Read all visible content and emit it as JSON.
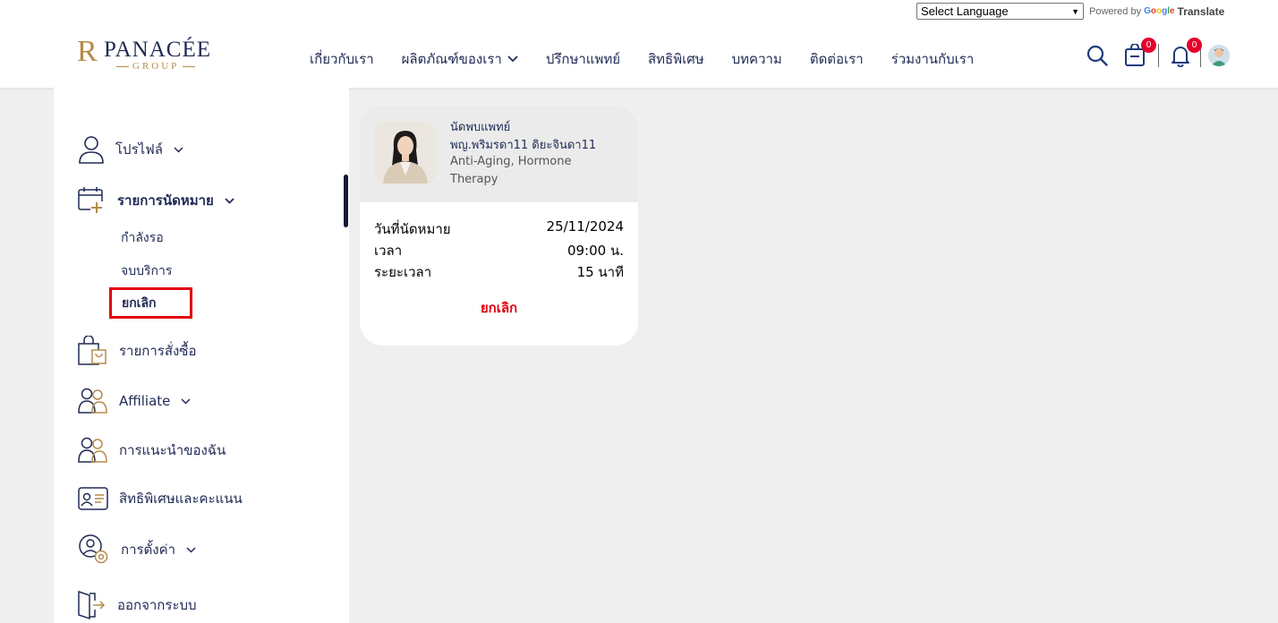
{
  "language": {
    "select_label": "Select Language",
    "powered_by": "Powered by",
    "google": "Google",
    "translate": "Translate"
  },
  "logo": {
    "monogram": "R",
    "name": "PANACÉE",
    "sub": "GROUP"
  },
  "nav": {
    "about": "เกี่ยวกับเรา",
    "products": "ผลิตภัณฑ์ของเรา",
    "consult": "ปรึกษาแพทย์",
    "privileges": "สิทธิพิเศษ",
    "articles": "บทความ",
    "contact": "ติดต่อเรา",
    "careers": "ร่วมงานกับเรา"
  },
  "header_icons": {
    "cart_count": "0",
    "notification_count": "0"
  },
  "sidebar": {
    "profile": "โปรไฟล์",
    "appointments": "รายการนัดหมาย",
    "sub": {
      "pending": "กำลังรอ",
      "completed": "จบบริการ",
      "cancelled": "ยกเลิก"
    },
    "orders": "รายการสั่งซื้อ",
    "affiliate": "Affiliate",
    "referrals": "การแนะนำของฉัน",
    "rewards": "สิทธิพิเศษและคะแนน",
    "settings": "การตั้งค่า",
    "logout": "ออกจากระบบ"
  },
  "appointment_card": {
    "label": "นัดพบแพทย์",
    "doctor_name": "พญ.พริมรดา11 ดิยะจินดา11",
    "specialty": "Anti-Aging, Hormone Therapy",
    "date_label": "วันที่นัดหมาย",
    "date_value": "25/11/2024",
    "time_label": "เวลา",
    "time_value": "09:00 น.",
    "duration_label": "ระยะเวลา",
    "duration_value": "15 นาที",
    "cancel_label": "ยกเลิก"
  },
  "colors": {
    "navy": "#1f2a55",
    "gold": "#b58b4a",
    "red": "#e3000f",
    "badge": "#e3002c",
    "background": "#efefef"
  }
}
